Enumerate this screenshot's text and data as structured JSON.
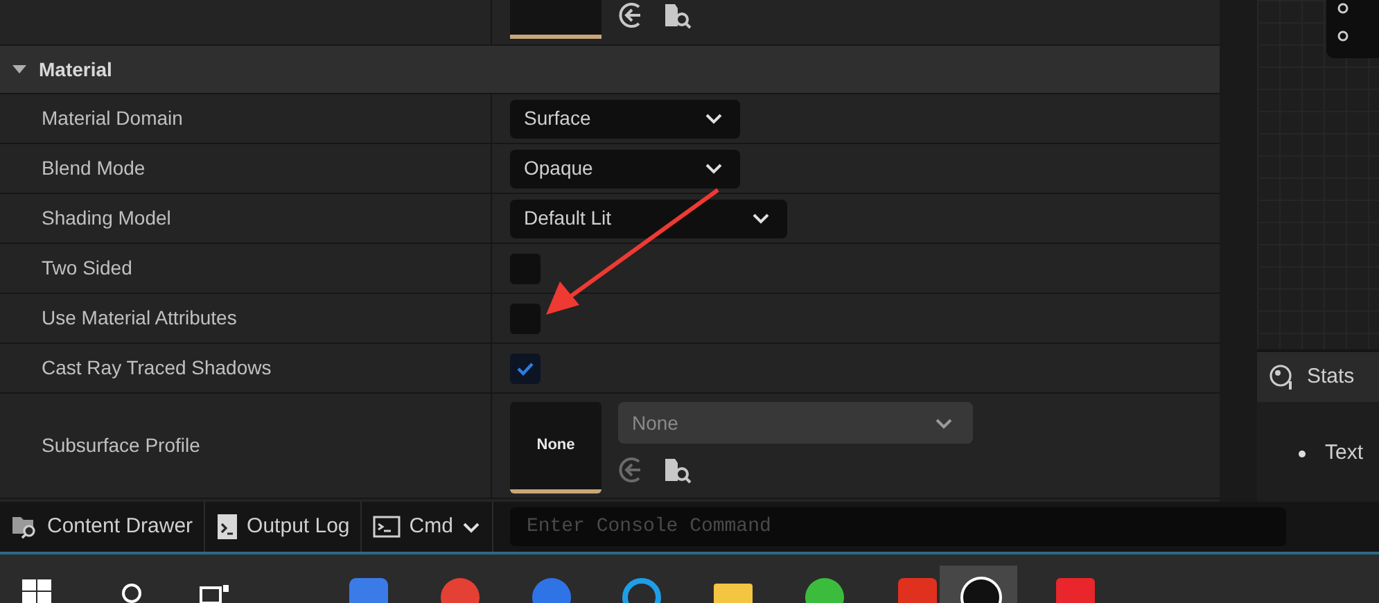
{
  "section": {
    "title": "Material",
    "expanded": true
  },
  "properties": [
    {
      "kind": "dropdown",
      "label": "Material Domain",
      "value": "Surface"
    },
    {
      "kind": "dropdown",
      "label": "Blend Mode",
      "value": "Opaque"
    },
    {
      "kind": "dropdown",
      "label": "Shading Model",
      "value": "Default Lit"
    },
    {
      "kind": "checkbox",
      "label": "Two Sided",
      "checked": false
    },
    {
      "kind": "checkbox",
      "label": "Use Material Attributes",
      "checked": false
    },
    {
      "kind": "checkbox",
      "label": "Cast Ray Traced Shadows",
      "checked": true
    },
    {
      "kind": "asset",
      "label": "Subsurface Profile",
      "thumbnail": "None",
      "value": "None"
    }
  ],
  "bottom_bar": {
    "tabs": [
      {
        "kind": "drawer",
        "label": "Content Drawer"
      },
      {
        "kind": "log",
        "label": "Output Log"
      },
      {
        "kind": "cmd",
        "label": "Cmd"
      }
    ],
    "console": {
      "placeholder": "Enter Console Command"
    }
  },
  "stats": {
    "title": "Stats",
    "items": [
      "Text"
    ]
  }
}
